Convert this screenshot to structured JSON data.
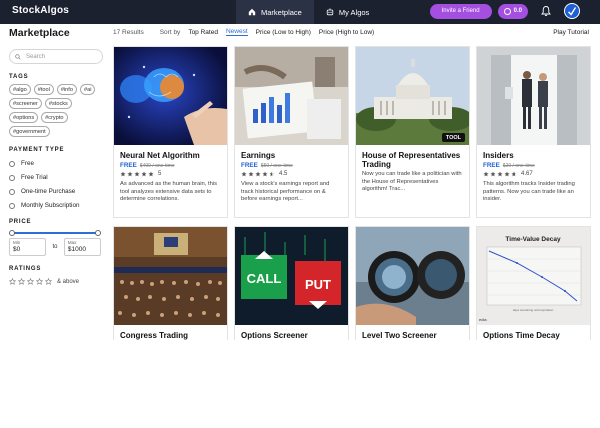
{
  "app": {
    "logo_text": "StockAlgos",
    "nav": [
      {
        "label": "Marketplace",
        "icon": "home-icon",
        "active": true
      },
      {
        "label": "My Algos",
        "icon": "robot-icon",
        "active": false
      }
    ],
    "invite_label": "Invite a Friend",
    "credits": "0.0",
    "bell_icon": "bell-icon"
  },
  "sidebar": {
    "title": "Marketplace",
    "search_placeholder": "Search",
    "tags_heading": "TAGS",
    "tags": [
      "#algo",
      "#tool",
      "#info",
      "#ai",
      "#screener",
      "#stocks",
      "#options",
      "#crypto",
      "#government"
    ],
    "payment_heading": "PAYMENT TYPE",
    "payment_options": [
      "Free",
      "Free Trial",
      "One-time Purchase",
      "Monthly Subscription"
    ],
    "price_heading": "PRICE",
    "price_min_label": "Min",
    "price_min_value": "$0",
    "price_to": "to",
    "price_max_label": "Max",
    "price_max_value": "$1000",
    "ratings_heading": "RATINGS",
    "ratings_suffix": "& above"
  },
  "sortbar": {
    "results": "17 Results",
    "sort_by": "Sort by",
    "options": [
      {
        "label": "Top Rated",
        "active": false
      },
      {
        "label": "Newest",
        "active": true
      },
      {
        "label": "Price (Low to High)",
        "active": false
      },
      {
        "label": "Price (High to Low)",
        "active": false
      }
    ],
    "tutorial": "Play Tutorial"
  },
  "cards": [
    {
      "title": "Neural Net Algorithm",
      "free": "FREE",
      "old_price": "$499 / one-time",
      "rating": "5",
      "stars": 5,
      "desc": "As advanced as the human brain, this tool analyzes extensive data sets to determine correlations."
    },
    {
      "title": "Earnings",
      "free": "FREE",
      "old_price": "$50 / one-time",
      "rating": "4.5",
      "stars": 4.5,
      "desc": "View a stock's earnings report and track historical performance on & before earnings report..."
    },
    {
      "title": "House of Representatives Trading",
      "badge": "TOOL",
      "desc": "Now you can trade like a politician with the House of Representatives algorithm! Trac..."
    },
    {
      "title": "Insiders",
      "free": "FREE",
      "old_price": "$20 / one-time",
      "rating": "4.67",
      "stars": 4.67,
      "desc": "This algorithm tracks Insider trading patterns. Now you can trade like an insider."
    },
    {
      "title": "Congress Trading"
    },
    {
      "title": "Options Screener",
      "call_label": "CALL",
      "put_label": "PUT"
    },
    {
      "title": "Level Two Screener"
    },
    {
      "title": "Options Time Decay",
      "chart_title": "Time-Value Decay",
      "chart_caption": "days remaining until expiration",
      "chart_footer": "edia"
    }
  ]
}
